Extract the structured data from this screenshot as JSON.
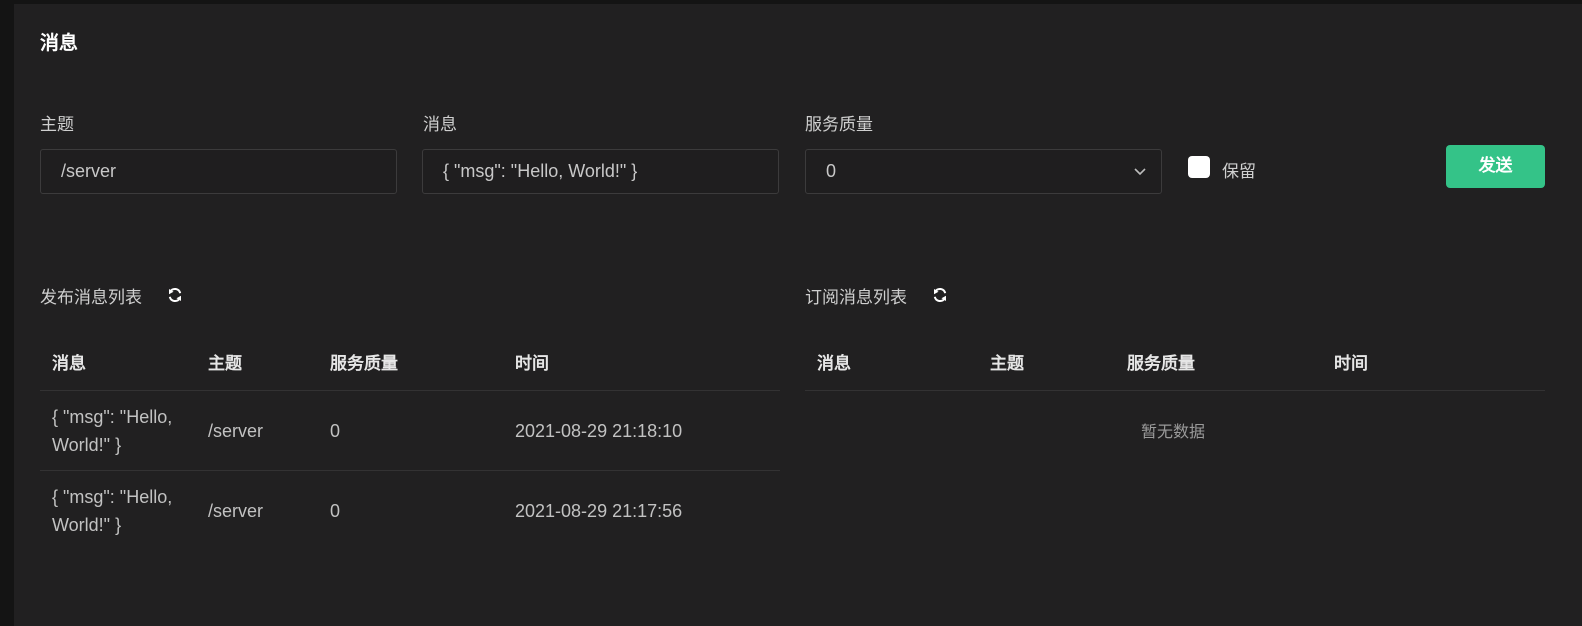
{
  "page_title": "消息",
  "form": {
    "topic_label": "主题",
    "topic_value": "/server",
    "message_label": "消息",
    "message_value": "{ \"msg\": \"Hello, World!\" }",
    "qos_label": "服务质量",
    "qos_value": "0",
    "retain_label": "保留",
    "retain_checked": false,
    "send_label": "发送"
  },
  "published": {
    "title": "发布消息列表",
    "columns": [
      "消息",
      "主题",
      "服务质量",
      "时间"
    ],
    "rows": [
      {
        "message": "{ \"msg\": \"Hello, World!\" }",
        "topic": "/server",
        "qos": "0",
        "time": "2021-08-29 21:18:10"
      },
      {
        "message": "{ \"msg\": \"Hello, World!\" }",
        "topic": "/server",
        "qos": "0",
        "time": "2021-08-29 21:17:56"
      }
    ]
  },
  "subscribed": {
    "title": "订阅消息列表",
    "columns": [
      "消息",
      "主题",
      "服务质量",
      "时间"
    ],
    "empty_text": "暂无数据"
  },
  "colors": {
    "accent": "#34c388",
    "background": "#212021"
  },
  "icons": {
    "refresh": "refresh-icon",
    "chevron": "chevron-down-icon"
  }
}
